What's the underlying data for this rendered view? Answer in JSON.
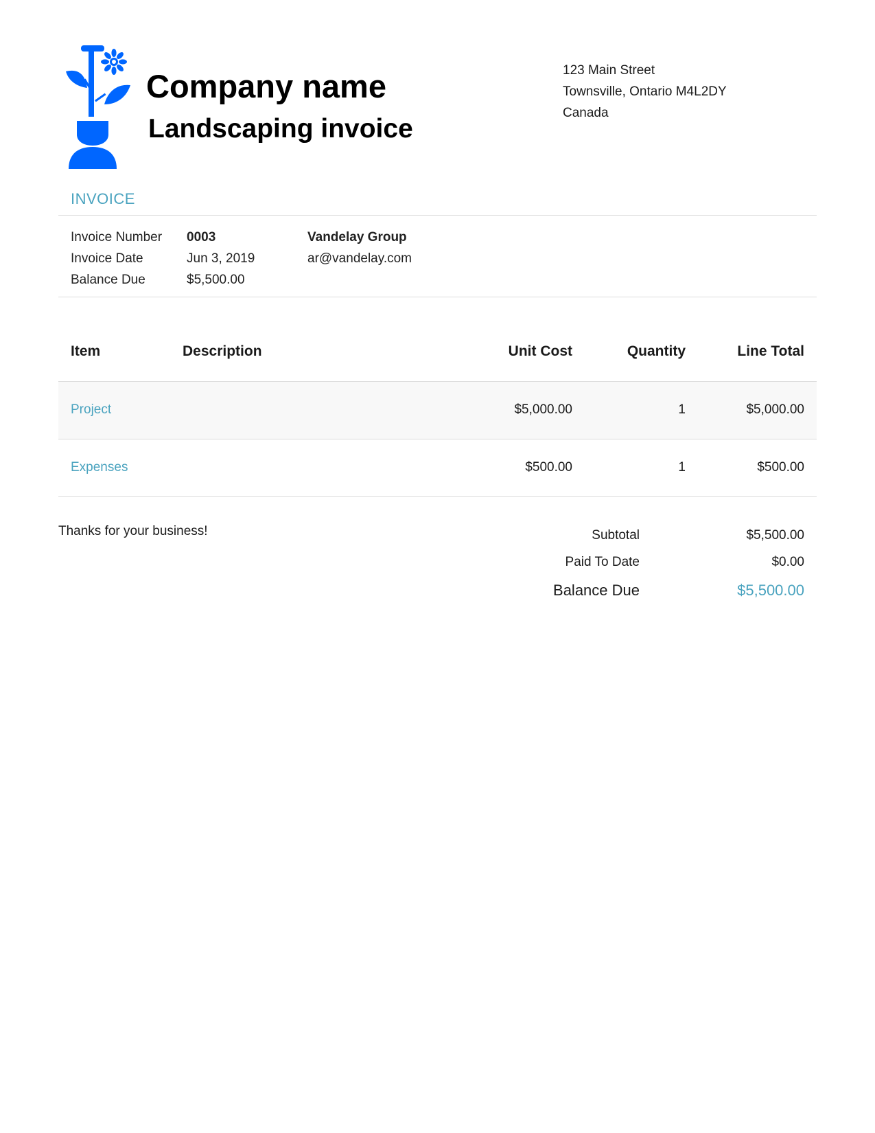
{
  "header": {
    "company_name": "Company name",
    "doc_title": "Landscaping invoice",
    "address": [
      "123 Main Street",
      "Townsville, Ontario M4L2DY",
      "Canada"
    ]
  },
  "invoice": {
    "section_label": "INVOICE",
    "fields": [
      {
        "label": "Invoice Number",
        "value": "0003"
      },
      {
        "label": "Invoice Date",
        "value": "Jun 3, 2019"
      },
      {
        "label": "Balance Due",
        "value": "$5,500.00"
      }
    ],
    "client": {
      "name": "Vandelay Group",
      "email": "ar@vandelay.com"
    }
  },
  "table": {
    "headers": {
      "item": "Item",
      "description": "Description",
      "unit_cost": "Unit Cost",
      "quantity": "Quantity",
      "line_total": "Line Total"
    },
    "rows": [
      {
        "item": "Project",
        "description": "",
        "unit_cost": "$5,000.00",
        "quantity": "1",
        "line_total": "$5,000.00"
      },
      {
        "item": "Expenses",
        "description": "",
        "unit_cost": "$500.00",
        "quantity": "1",
        "line_total": "$500.00"
      }
    ]
  },
  "footer": {
    "thanks": "Thanks for your business!",
    "totals": [
      {
        "label": "Subtotal",
        "value": "$5,500.00"
      },
      {
        "label": "Paid To Date",
        "value": "$0.00"
      },
      {
        "label": "Balance Due",
        "value": "$5,500.00"
      }
    ]
  },
  "colors": {
    "accent": "#4aa3bf",
    "logo": "#0066ff",
    "row_shade": "#f8f8f8",
    "rule": "#dcdcdc"
  }
}
